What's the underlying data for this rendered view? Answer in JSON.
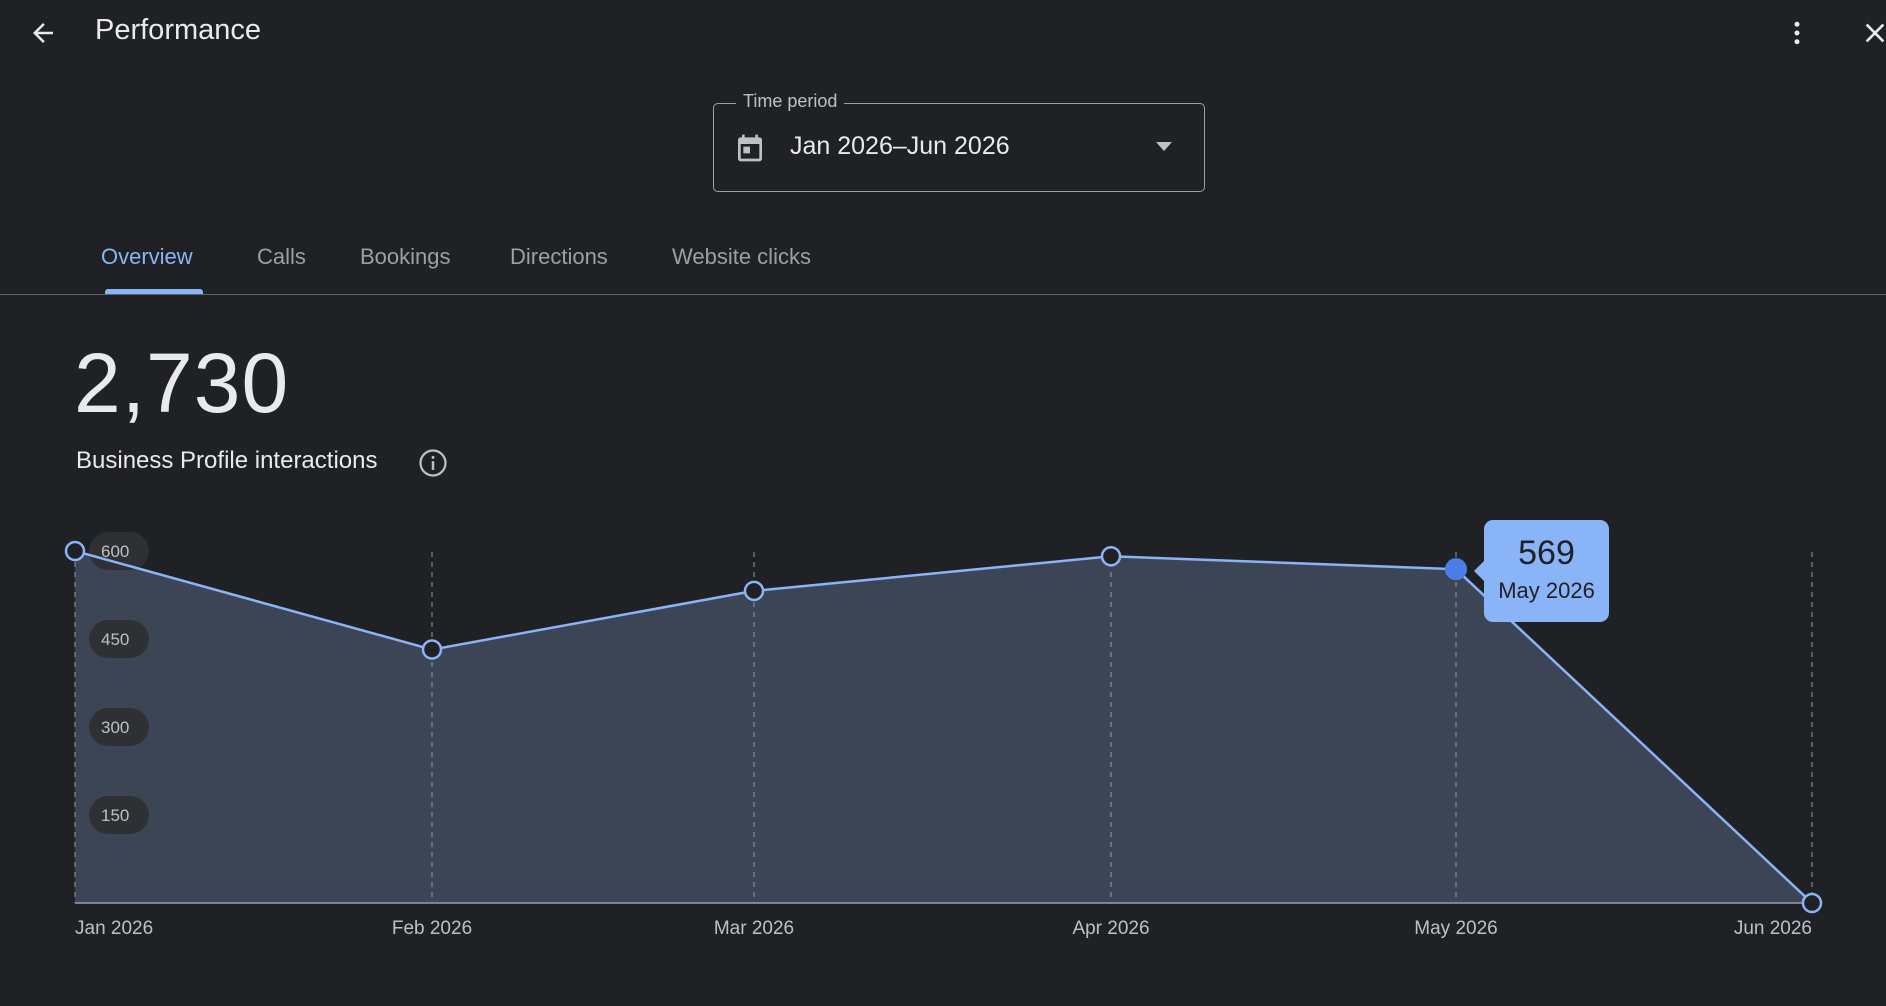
{
  "header": {
    "title": "Performance",
    "back_icon": "arrow-back-icon",
    "more_icon": "more-vert-icon",
    "close_icon": "close-icon"
  },
  "time_period": {
    "label": "Time period",
    "value": "Jan 2026–Jun 2026",
    "icon": "calendar-icon"
  },
  "tabs": [
    {
      "label": "Overview",
      "active": true
    },
    {
      "label": "Calls",
      "active": false
    },
    {
      "label": "Bookings",
      "active": false
    },
    {
      "label": "Directions",
      "active": false
    },
    {
      "label": "Website clicks",
      "active": false
    }
  ],
  "summary": {
    "total": "2,730",
    "label": "Business Profile interactions",
    "info_icon": "info-icon"
  },
  "tooltip": {
    "value": "569",
    "period": "May 2026"
  },
  "colors": {
    "background": "#202124",
    "accent": "#8ab4f8",
    "highlight_point": "#4a7ee6",
    "area_fill": "#3c4556"
  },
  "chart_data": {
    "type": "area",
    "categories": [
      "Jan 2026",
      "Feb 2026",
      "Mar 2026",
      "Apr 2026",
      "May 2026",
      "Jun 2026"
    ],
    "values": [
      600,
      432,
      532,
      591,
      569,
      0
    ],
    "yticks": [
      150,
      300,
      450,
      600
    ],
    "ylim": [
      0,
      600
    ],
    "highlight_index": 4,
    "grid": "vertical dashed"
  }
}
